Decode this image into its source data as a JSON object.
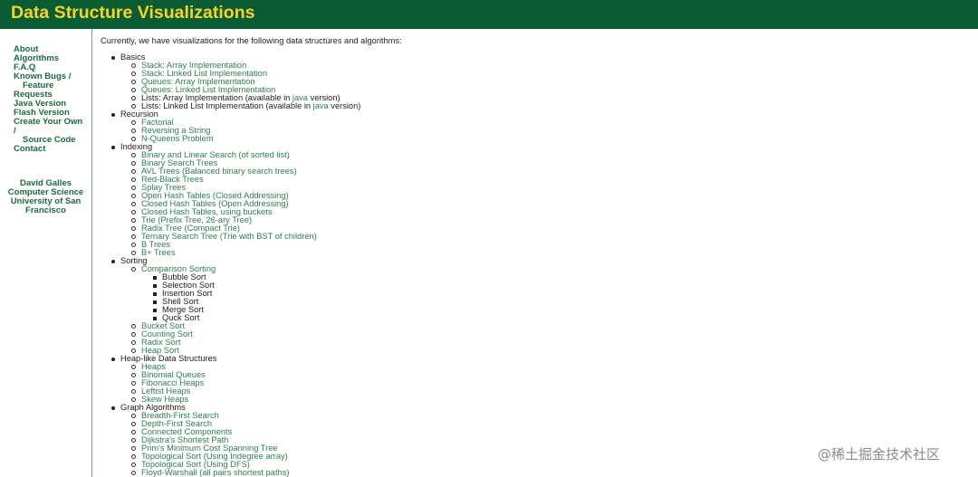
{
  "header": {
    "title": "Data Structure Visualizations"
  },
  "sidebar": {
    "nav": [
      {
        "label": "About"
      },
      {
        "label": "Algorithms"
      },
      {
        "label": "F.A.Q"
      },
      {
        "label": "Known Bugs /"
      },
      {
        "label": "Feature",
        "indent": true
      },
      {
        "label": "Requests"
      },
      {
        "label": "Java Version"
      },
      {
        "label": "Flash Version"
      },
      {
        "label": "Create Your Own"
      },
      {
        "label": "/"
      },
      {
        "label": "Source Code",
        "indent": true
      },
      {
        "label": "Contact"
      }
    ],
    "author": [
      "David Galles",
      "Computer Science",
      "University of San",
      "Francisco"
    ]
  },
  "main": {
    "intro": "Currently, we have visualizations for the following data structures and algorithms:",
    "categories": [
      {
        "label": "Basics",
        "items": [
          {
            "label": "Stack: Array Implementation",
            "link": true
          },
          {
            "label": "Stack: Linked List Implementation",
            "link": true
          },
          {
            "label": "Queues: Array Implementation",
            "link": true
          },
          {
            "label": "Queues: Linked List Implementation",
            "link": true
          },
          {
            "parts": [
              "Lists: Array Implementation (available in ",
              "java",
              " version)"
            ]
          },
          {
            "parts": [
              "Lists: Linked List Implementation (available in ",
              "java",
              " version)"
            ]
          }
        ]
      },
      {
        "label": "Recursion",
        "items": [
          {
            "label": "Factorial",
            "link": true
          },
          {
            "label": "Reversing a String",
            "link": true
          },
          {
            "label": "N-Queens Problem",
            "link": true
          }
        ]
      },
      {
        "label": "Indexing",
        "items": [
          {
            "label": "Binary and Linear Search (of sorted list)",
            "link": true
          },
          {
            "label": "Binary Search Trees",
            "link": true
          },
          {
            "label": "AVL Trees (Balanced binary search trees)",
            "link": true
          },
          {
            "label": "Red-Black Trees",
            "link": true
          },
          {
            "label": "Splay Trees",
            "link": true
          },
          {
            "label": "Open Hash Tables (Closed Addressing)",
            "link": true
          },
          {
            "label": "Closed Hash Tables (Open Addressing)",
            "link": true
          },
          {
            "label": "Closed Hash Tables, using buckets",
            "link": true
          },
          {
            "label": "Trie (Prefix Tree, 26-ary Tree)",
            "link": true
          },
          {
            "label": "Radix Tree (Compact Trie)",
            "link": true
          },
          {
            "label": "Ternary Search Tree (Trie with BST of children)",
            "link": true
          },
          {
            "label": "B Trees",
            "link": true
          },
          {
            "label": "B+ Trees",
            "link": true
          }
        ]
      },
      {
        "label": "Sorting",
        "items": [
          {
            "label": "Comparison Sorting",
            "link": true,
            "subitems": [
              "Bubble Sort",
              "Selection Sort",
              "Insertion Sort",
              "Shell Sort",
              "Merge Sort",
              "Quck Sort"
            ]
          },
          {
            "label": "Bucket Sort",
            "link": true
          },
          {
            "label": "Counting Sort",
            "link": true
          },
          {
            "label": "Radix Sort",
            "link": true
          },
          {
            "label": "Heap Sort",
            "link": true
          }
        ]
      },
      {
        "label": "Heap-like Data Structures",
        "items": [
          {
            "label": "Heaps",
            "link": true
          },
          {
            "label": "Binomial Queues",
            "link": true
          },
          {
            "label": "Fibonacci Heaps",
            "link": true
          },
          {
            "label": "Leftist Heaps",
            "link": true
          },
          {
            "label": "Skew Heaps",
            "link": true
          }
        ]
      },
      {
        "label": "Graph Algorithms",
        "items": [
          {
            "label": "Breadth-First Search",
            "link": true
          },
          {
            "label": "Depth-First Search",
            "link": true
          },
          {
            "label": "Connected Components",
            "link": true
          },
          {
            "label": "Dijkstra's Shortest Path",
            "link": true
          },
          {
            "label": "Prim's Minimum Cost Spanning Tree",
            "link": true
          },
          {
            "label": "Topological Sort (Using Indegree array)",
            "link": true
          },
          {
            "label": "Topological Sort (Using DFS)",
            "link": true
          },
          {
            "label": "Floyd-Warshall (all pairs shortest paths)",
            "link": true
          }
        ]
      }
    ]
  },
  "watermark": "@稀土掘金技术社区",
  "colors": {
    "header_bg": "#0a5c34",
    "title": "#f5d328",
    "link": "#2e7d4f",
    "nav_link": "#1a6b3d"
  }
}
